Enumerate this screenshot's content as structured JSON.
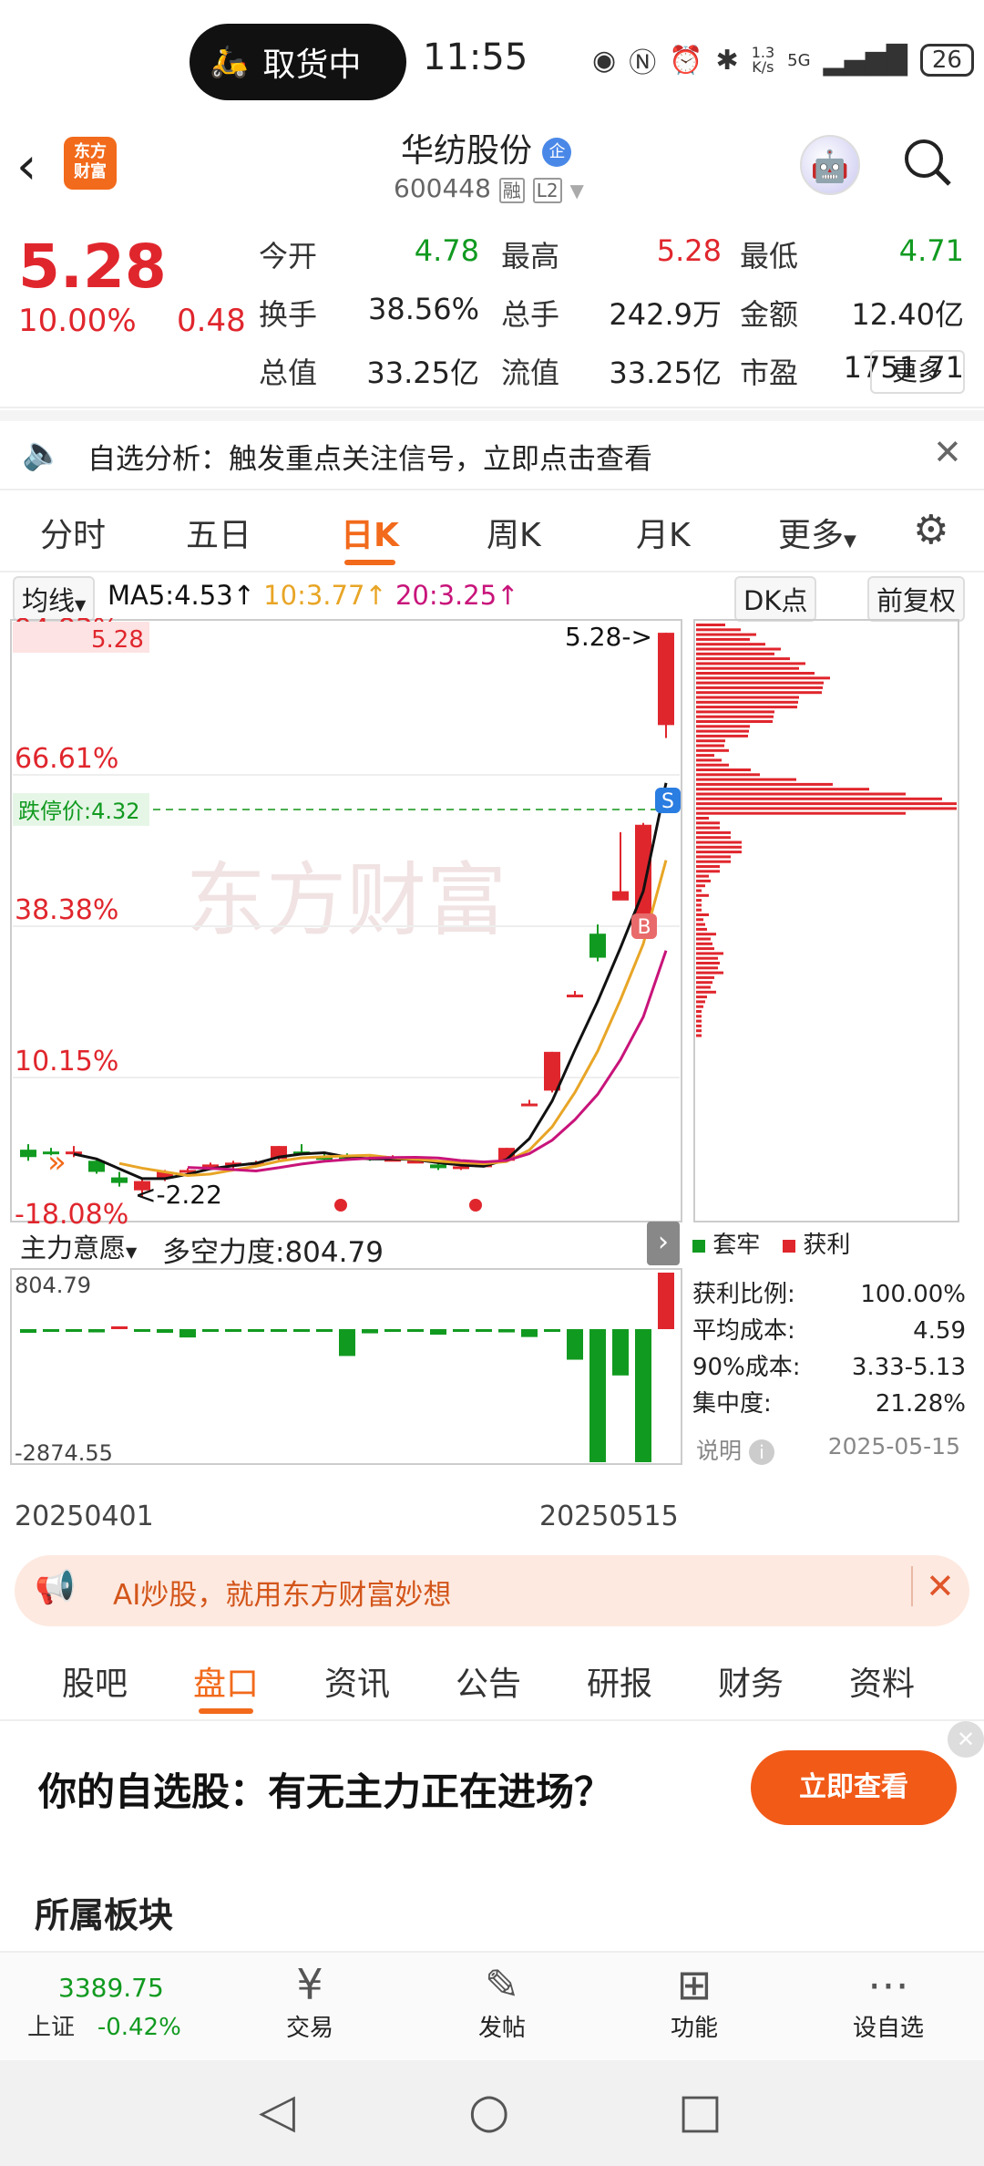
{
  "status": {
    "pill_text": "取货中",
    "time": "11:55",
    "speed_top": "1.3",
    "speed_unit": "K/s",
    "net": "5G",
    "battery": "26"
  },
  "header": {
    "logo_text": "东方\n财富",
    "title": "华纺股份",
    "badge": "企",
    "code": "600448",
    "tag1": "融",
    "tag2": "L2"
  },
  "quote": {
    "price": "5.28",
    "change_pct": "10.00%",
    "change": "0.48",
    "rows": [
      [
        {
          "label": "今开",
          "value": "4.78",
          "color": "green"
        },
        {
          "label": "最高",
          "value": "5.28",
          "color": "red"
        },
        {
          "label": "最低",
          "value": "4.71",
          "color": "green"
        }
      ],
      [
        {
          "label": "换手",
          "value": "38.56%",
          "color": "dark"
        },
        {
          "label": "总手",
          "value": "242.9万",
          "color": "dark"
        },
        {
          "label": "金额",
          "value": "12.40亿",
          "color": "dark"
        }
      ],
      [
        {
          "label": "总值",
          "value": "33.25亿",
          "color": "dark"
        },
        {
          "label": "流值",
          "value": "33.25亿",
          "color": "dark"
        },
        {
          "label": "市盈",
          "value": "1751.71",
          "color": "dark"
        }
      ]
    ],
    "pe_sup": "动",
    "more": "更多"
  },
  "banner": {
    "text": "自选分析：触发重点关注信号，立即点击查看"
  },
  "tabs": [
    "分时",
    "五日",
    "日K",
    "周K",
    "月K",
    "更多"
  ],
  "active_tab": "日K",
  "chart_bar": {
    "ma_select": "均线",
    "ma5": "MA5:4.53↑",
    "ma10": "10:3.77↑",
    "ma20": "20:3.25↑",
    "dk": "DK点",
    "fq": "前复权"
  },
  "chart_data": {
    "type": "candlestick",
    "y_axis_labels": [
      "94.83%",
      "66.61%",
      "38.38%",
      "10.15%",
      "-18.08%"
    ],
    "top_label": "5.28",
    "limit_label": "跌停价:4.32",
    "max_marker": "5.28->",
    "min_marker": "<-2.22",
    "watermark": "东方财富",
    "signals": [
      "S",
      "B"
    ],
    "ma_colors": {
      "ma5": "#111111",
      "ma10": "#e8a526",
      "ma20": "#c8147a"
    },
    "candles": [
      {
        "o": 2.48,
        "c": 2.44,
        "h": 2.51,
        "l": 2.42
      },
      {
        "o": 2.47,
        "c": 2.46,
        "h": 2.49,
        "l": 2.45
      },
      {
        "o": 2.46,
        "c": 2.47,
        "h": 2.5,
        "l": 2.44
      },
      {
        "o": 2.42,
        "c": 2.36,
        "h": 2.43,
        "l": 2.35
      },
      {
        "o": 2.33,
        "c": 2.3,
        "h": 2.36,
        "l": 2.28
      },
      {
        "o": 2.26,
        "c": 2.31,
        "h": 2.33,
        "l": 2.22
      },
      {
        "o": 2.33,
        "c": 2.36,
        "h": 2.37,
        "l": 2.31
      },
      {
        "o": 2.36,
        "c": 2.37,
        "h": 2.38,
        "l": 2.35
      },
      {
        "o": 2.38,
        "c": 2.4,
        "h": 2.41,
        "l": 2.37
      },
      {
        "o": 2.4,
        "c": 2.41,
        "h": 2.42,
        "l": 2.38
      },
      {
        "o": 2.4,
        "c": 2.41,
        "h": 2.42,
        "l": 2.39
      },
      {
        "o": 2.43,
        "c": 2.5,
        "h": 2.5,
        "l": 2.42
      },
      {
        "o": 2.47,
        "c": 2.46,
        "h": 2.51,
        "l": 2.45
      },
      {
        "o": 2.44,
        "c": 2.43,
        "h": 2.46,
        "l": 2.42
      },
      {
        "o": 2.44,
        "c": 2.43,
        "h": 2.46,
        "l": 2.43
      },
      {
        "o": 2.44,
        "c": 2.43,
        "h": 2.45,
        "l": 2.42
      },
      {
        "o": 2.42,
        "c": 2.43,
        "h": 2.45,
        "l": 2.42
      },
      {
        "o": 2.42,
        "c": 2.42,
        "h": 2.44,
        "l": 2.41
      },
      {
        "o": 2.4,
        "c": 2.38,
        "h": 2.42,
        "l": 2.37
      },
      {
        "o": 2.38,
        "c": 2.39,
        "h": 2.41,
        "l": 2.37
      },
      {
        "o": 2.4,
        "c": 2.4,
        "h": 2.42,
        "l": 2.39
      },
      {
        "o": 2.42,
        "c": 2.49,
        "h": 2.49,
        "l": 2.41
      },
      {
        "o": 2.73,
        "c": 2.73,
        "h": 2.75,
        "l": 2.72
      },
      {
        "o": 2.8,
        "c": 3.01,
        "h": 3.01,
        "l": 2.79
      },
      {
        "o": 3.32,
        "c": 3.32,
        "h": 3.34,
        "l": 3.31
      },
      {
        "o": 3.65,
        "c": 3.52,
        "h": 3.7,
        "l": 3.5
      },
      {
        "o": 3.83,
        "c": 3.88,
        "h": 4.2,
        "l": 3.85
      },
      {
        "o": 3.7,
        "c": 4.24,
        "h": 4.25,
        "l": 3.68
      },
      {
        "o": 4.78,
        "c": 5.28,
        "h": 5.28,
        "l": 4.71
      }
    ],
    "oscillator": {
      "label": "主力意愿",
      "name": "多空力度",
      "value": "804.79",
      "max": "804.79",
      "min": "-2874.55",
      "values": [
        -80,
        -60,
        -20,
        -70,
        40,
        -30,
        -80,
        -180,
        -30,
        -20,
        -30,
        -20,
        -40,
        -30,
        -580,
        -90,
        -20,
        -50,
        -120,
        -40,
        -50,
        -70,
        -170,
        -60,
        -660,
        -2874,
        -1000,
        -2874,
        804.79
      ]
    },
    "x_labels": [
      "20250401",
      "20250515"
    ]
  },
  "chip_legend": {
    "loss": "套牢",
    "profit": "获利"
  },
  "chip_stats": [
    {
      "label": "获利比例:",
      "value": "100.00%"
    },
    {
      "label": "平均成本:",
      "value": "4.59"
    },
    {
      "label": "90%成本:",
      "value": "3.33-5.13"
    },
    {
      "label": "集中度:",
      "value": "21.28%"
    }
  ],
  "chip_note": {
    "label": "说明",
    "date": "2025-05-15"
  },
  "ai_banner": {
    "text": "AI炒股，就用东方财富妙想"
  },
  "bottom_tabs": [
    "股吧",
    "盘口",
    "资讯",
    "公告",
    "研报",
    "财务",
    "资料"
  ],
  "bottom_active": "盘口",
  "promo": {
    "text": "你的自选股：有无主力正在进场？",
    "button": "立即查看"
  },
  "section_title": "所属板块",
  "bottom_bar": {
    "index_value": "3389.75",
    "index_name": "上证",
    "index_change": "-0.42%",
    "items": [
      "交易",
      "发帖",
      "功能",
      "设自选"
    ]
  },
  "colors": {
    "up": "#e0262d",
    "down": "#119a20",
    "accent": "#f26a1b"
  }
}
